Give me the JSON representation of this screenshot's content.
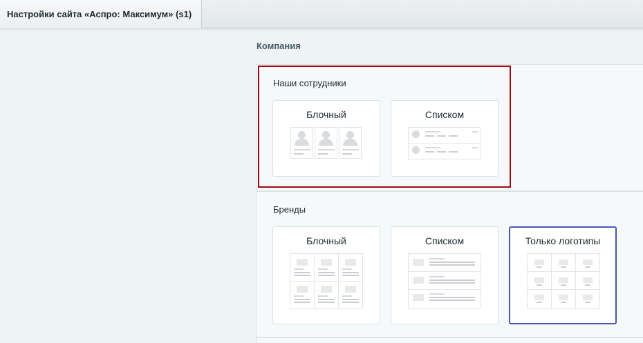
{
  "window": {
    "tab_title": "Настройки сайта «Аспро: Максимум» (s1)"
  },
  "section": {
    "title": "Компания"
  },
  "staff": {
    "label": "Наши сотрудники",
    "options": [
      {
        "label": "Блочный",
        "selected": true
      },
      {
        "label": "Списком",
        "selected": false
      }
    ]
  },
  "brands": {
    "label": "Бренды",
    "options": [
      {
        "label": "Блочный",
        "selected": false
      },
      {
        "label": "Списком",
        "selected": false
      },
      {
        "label": "Только логотипы",
        "selected": true
      }
    ]
  },
  "colors": {
    "selected_border": "#4957b3",
    "highlight_border": "#a1080f"
  }
}
